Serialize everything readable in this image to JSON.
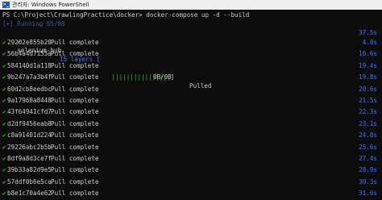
{
  "window": {
    "title": "관리자: Windows PowerShell",
    "icon": "powershell-icon"
  },
  "terminal": {
    "command_line": "PS C:\\Project\\CrawlingPractice\\docker> docker-compose up -d --build",
    "running_line": "[+] Running 65/80",
    "stack": {
      "name": "selenium-hub",
      "layers_label": "15 layers [",
      "progress_glyphs": "||||||||||||||||",
      "progress_close": "]",
      "speed": "0B/0B",
      "status": "Pulled",
      "time": "37.5s"
    },
    "layers": [
      {
        "id": "29202e855b20",
        "status": "Pull complete",
        "time": "4.8s"
      },
      {
        "id": "56b4a4d7155a",
        "status": "Pull complete",
        "time": "16.6s"
      },
      {
        "id": "584140d1a118",
        "status": "Pull complete",
        "time": "19.4s"
      },
      {
        "id": "9b247a7a3b4f",
        "status": "Pull complete",
        "time": "19.8s"
      },
      {
        "id": "60d2cb8eedbc",
        "status": "Pull complete",
        "time": "20.6s"
      },
      {
        "id": "9a17968a8448",
        "status": "Pull complete",
        "time": "21.5s"
      },
      {
        "id": "43f64941cfd7",
        "status": "Pull complete",
        "time": "22.3s"
      },
      {
        "id": "d2df9456eab8",
        "status": "Pull complete",
        "time": "23.1s"
      },
      {
        "id": "c8a91401d224",
        "status": "Pull complete",
        "time": "24.0s"
      },
      {
        "id": "29226abc2b5b",
        "status": "Pull complete",
        "time": "25.6s"
      },
      {
        "id": "8df9a8d3ce7f",
        "status": "Pull complete",
        "time": "27.4s"
      },
      {
        "id": "39b33a82d9e5",
        "status": "Pull complete",
        "time": "28.9s"
      },
      {
        "id": "57ddf0b6e5ca",
        "status": "Pull complete",
        "time": "30.3s"
      },
      {
        "id": "b8e1c70a4e62",
        "status": "Pull complete",
        "time": "31.6s"
      }
    ]
  },
  "colors": {
    "background": "#0c0c0c",
    "text": "#cccccc",
    "check": "#16c60c",
    "time": "#3b78ff",
    "running": "#2f5ea8"
  }
}
